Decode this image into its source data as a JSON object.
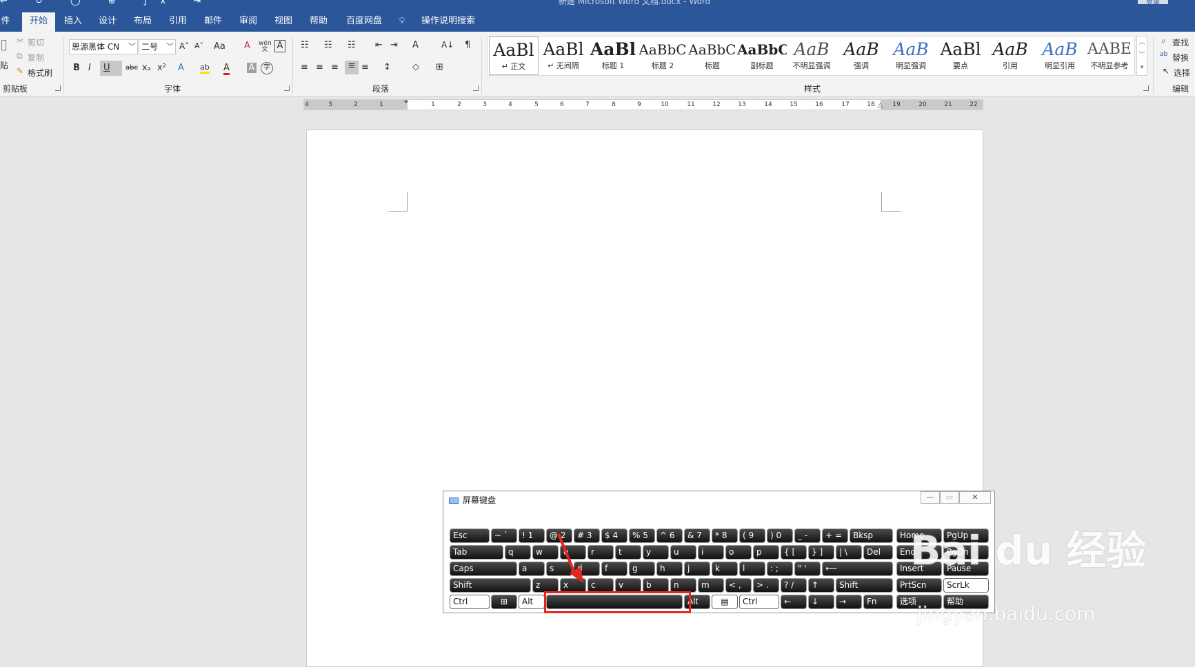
{
  "window": {
    "title": "新建 Microsoft Word 文档.docx - Word",
    "quick_access": "↩ ↻ ◯ ⊕ ∫x ⇥",
    "signin": "登录"
  },
  "tabs": [
    "件",
    "开始",
    "插入",
    "设计",
    "布局",
    "引用",
    "邮件",
    "审阅",
    "视图",
    "帮助",
    "百度网盘",
    "操作说明搜索"
  ],
  "clipboard": {
    "paste": "贴",
    "cut": "剪切",
    "copy": "复制",
    "format_painter": "格式刷",
    "label": "剪贴板"
  },
  "font": {
    "name": "思源黑体 CN",
    "size": "二号",
    "label": "字体",
    "grow": "A˄",
    "shrink": "A˅",
    "case": "Aa",
    "clear": "A",
    "phonetic": "wén文",
    "border": "A",
    "bold": "B",
    "italic": "I",
    "underline": "U",
    "strike": "abc",
    "sub": "x₂",
    "sup": "x²",
    "effect": "A",
    "highlight": "ab",
    "color": "A",
    "shade": "A",
    "enclose": "字"
  },
  "paragraph": {
    "label": "段落",
    "bullets": "☷",
    "numbering": "☷",
    "multilevel": "☷",
    "dec_indent": "⇤",
    "inc_indent": "⇥",
    "chinese_layout": "A",
    "sort": "A↓",
    "marks": "¶",
    "align_left": "≡",
    "center": "≡",
    "align_right": "≡",
    "justify": "≡",
    "distributed": "≡",
    "line_spacing": "↕",
    "shading": "◇",
    "borders": "⊞"
  },
  "styles": {
    "label": "样式",
    "items": [
      {
        "preview": "AaBl",
        "name": "↵ 正文"
      },
      {
        "preview": "AaBl",
        "name": "↵ 无间隔"
      },
      {
        "preview": "AaBl",
        "name": "标题 1"
      },
      {
        "preview": "AaBbC",
        "name": "标题 2"
      },
      {
        "preview": "AaBbC",
        "name": "标题"
      },
      {
        "preview": "AaBbC",
        "name": "副标题"
      },
      {
        "preview": "AaB",
        "name": "不明显强调"
      },
      {
        "preview": "AaB",
        "name": "强调"
      },
      {
        "preview": "AaB",
        "name": "明显强调"
      },
      {
        "preview": "AaBl",
        "name": "要点"
      },
      {
        "preview": "AaB",
        "name": "引用"
      },
      {
        "preview": "AaB",
        "name": "明显引用"
      },
      {
        "preview": "AABE",
        "name": "不明显参考"
      }
    ]
  },
  "editing": {
    "find": "查找",
    "replace": "替换",
    "select": "选择",
    "label": "编辑"
  },
  "ruler": {
    "ticks": [
      "4",
      "2",
      "2",
      "4",
      "6",
      "8",
      "10",
      "12",
      "14",
      "16",
      "18",
      "20",
      "22",
      "24",
      "26",
      "28",
      "30",
      "32",
      "34",
      "36",
      "38",
      "40",
      "42",
      "44"
    ],
    "labels": [
      "4",
      "3",
      "2",
      "1",
      "1",
      "2",
      "3",
      "4",
      "5",
      "6",
      "7",
      "8",
      "9",
      "10",
      "11",
      "12",
      "13",
      "14",
      "15",
      "16",
      "17",
      "18",
      "19",
      "20",
      "21",
      "22"
    ]
  },
  "osk": {
    "title": "屏幕键盘",
    "min": "—",
    "max": "▭",
    "close": "✕",
    "row1": [
      {
        "k": "Esc"
      },
      {
        "k": "~ `"
      },
      {
        "k": "! 1"
      },
      {
        "k": "@ 2"
      },
      {
        "k": "# 3"
      },
      {
        "k": "$ 4"
      },
      {
        "k": "% 5"
      },
      {
        "k": "^ 6"
      },
      {
        "k": "& 7"
      },
      {
        "k": "* 8"
      },
      {
        "k": "( 9"
      },
      {
        "k": ") 0"
      },
      {
        "k": "_ -"
      },
      {
        "k": "+ ="
      },
      {
        "k": "Bksp"
      },
      {
        "k": "Home"
      },
      {
        "k": "PgUp"
      }
    ],
    "row2": [
      {
        "k": "Tab"
      },
      {
        "k": "q"
      },
      {
        "k": "w"
      },
      {
        "k": "e"
      },
      {
        "k": "r"
      },
      {
        "k": "t"
      },
      {
        "k": "y"
      },
      {
        "k": "u"
      },
      {
        "k": "i"
      },
      {
        "k": "o"
      },
      {
        "k": "p"
      },
      {
        "k": "{ ["
      },
      {
        "k": "} ]"
      },
      {
        "k": "| \\"
      },
      {
        "k": "Del"
      },
      {
        "k": "End"
      },
      {
        "k": "PgDn"
      }
    ],
    "row3": [
      {
        "k": "Caps"
      },
      {
        "k": "a"
      },
      {
        "k": "s"
      },
      {
        "k": "d"
      },
      {
        "k": "f"
      },
      {
        "k": "g"
      },
      {
        "k": "h"
      },
      {
        "k": "j"
      },
      {
        "k": "k"
      },
      {
        "k": "l"
      },
      {
        "k": ": ;"
      },
      {
        "k": "\" '"
      },
      {
        "k": "⟵"
      },
      {
        "k": "Insert"
      },
      {
        "k": "Pause"
      }
    ],
    "row4": [
      {
        "k": "Shift"
      },
      {
        "k": "z"
      },
      {
        "k": "x"
      },
      {
        "k": "c"
      },
      {
        "k": "v"
      },
      {
        "k": "b"
      },
      {
        "k": "n"
      },
      {
        "k": "m"
      },
      {
        "k": "< ,"
      },
      {
        "k": "> ."
      },
      {
        "k": "? /"
      },
      {
        "k": "↑"
      },
      {
        "k": "Shift"
      },
      {
        "k": "PrtScn"
      },
      {
        "k": "ScrLk"
      }
    ],
    "row5": [
      {
        "k": "Ctrl"
      },
      {
        "k": "⊞"
      },
      {
        "k": "Alt"
      },
      {
        "k": ""
      },
      {
        "k": "Alt"
      },
      {
        "k": "▤"
      },
      {
        "k": "Ctrl"
      },
      {
        "k": "←"
      },
      {
        "k": "↓"
      },
      {
        "k": "→"
      },
      {
        "k": "Fn"
      },
      {
        "k": "选项"
      },
      {
        "k": "帮助"
      }
    ]
  },
  "watermark": {
    "logo": "Bai du 经验",
    "url": "jingyan.baidu.com"
  },
  "colors": {
    "brand": "#2b579a",
    "highlight_box": "#e8241c",
    "arrow": "#e8241c"
  }
}
